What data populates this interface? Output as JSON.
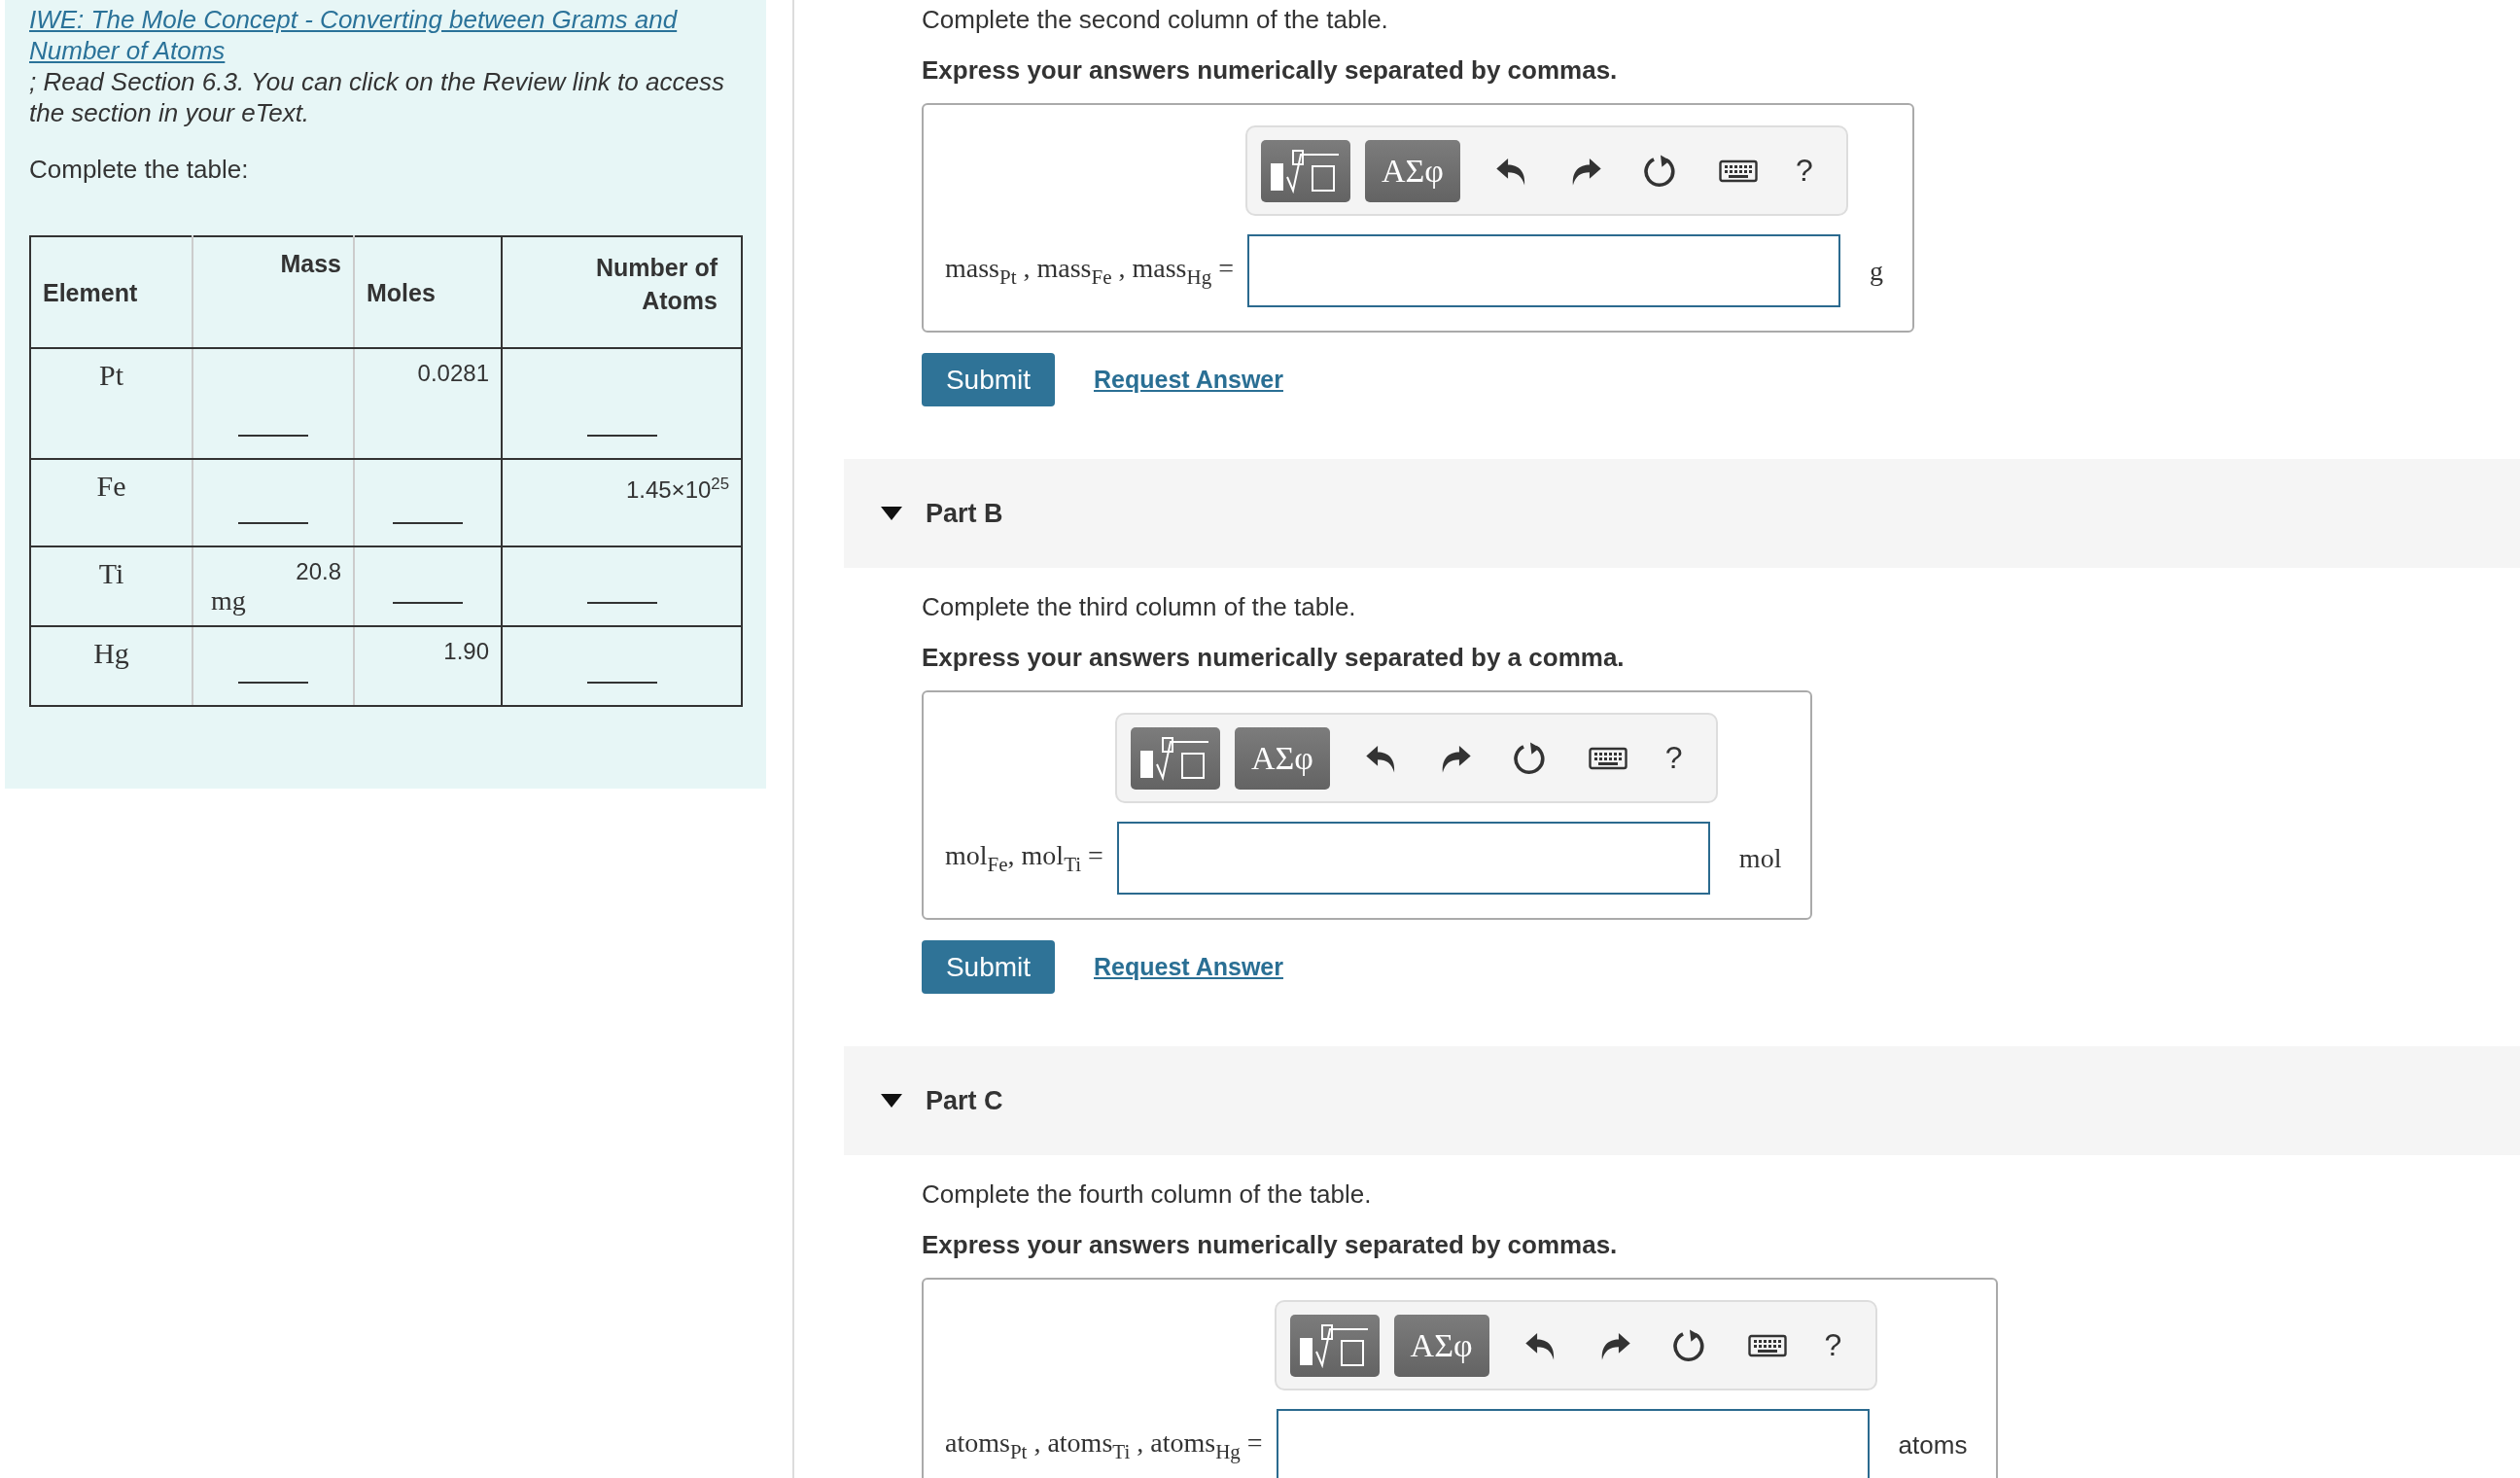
{
  "intro": {
    "link": "IWE: The Mole Concept - Converting between Grams and Number of Atoms",
    "note": "; Read Section 6.3. You can click on the Review link to access the section in your eText.",
    "instruction": "Complete the table:"
  },
  "table": {
    "columns": [
      "Element",
      "Mass",
      "Moles",
      "Number of Atoms"
    ],
    "rows": [
      {
        "cells": [
          {
            "kind": "element",
            "text": "Pt"
          },
          {
            "kind": "blank"
          },
          {
            "kind": "value",
            "text": "0.0281"
          },
          {
            "kind": "blank"
          }
        ]
      },
      {
        "cells": [
          {
            "kind": "element",
            "text": "Fe"
          },
          {
            "kind": "blank"
          },
          {
            "kind": "blank"
          },
          {
            "kind": "value",
            "text": "1.45×10$^{25}$"
          }
        ]
      },
      {
        "cells": [
          {
            "kind": "element",
            "text": "Ti"
          },
          {
            "kind": "value",
            "text": "20.8",
            "unit": "mg"
          },
          {
            "kind": "blank"
          },
          {
            "kind": "blank"
          }
        ]
      },
      {
        "cells": [
          {
            "kind": "element",
            "text": "Hg"
          },
          {
            "kind": "blank"
          },
          {
            "kind": "value",
            "text": "1.90"
          },
          {
            "kind": "blank"
          }
        ]
      }
    ]
  },
  "parts": [
    {
      "prompt": "Complete the second column of the table.",
      "instruction": "Express your answers numerically separated by commas.",
      "toolbar": {
        "symbols": "ΑΣφ",
        "help": "?"
      },
      "label": "mass$_{Pt}$ , mass$_{Fe}$ , mass$_{Hg}$ =",
      "unit": "g",
      "submit": "Submit",
      "request": "Request Answer"
    },
    {
      "header": {
        "title": "Part B",
        "expanded": true
      },
      "prompt": "Complete the third column of the table.",
      "instruction": "Express your answers numerically separated by a comma.",
      "toolbar": {
        "symbols": "ΑΣφ",
        "help": "?"
      },
      "label": "mol$_{Fe}$, mol$_{Ti}$ =",
      "unit": "mol",
      "submit": "Submit",
      "request": "Request Answer"
    },
    {
      "header": {
        "title": "Part C",
        "expanded": true
      },
      "prompt": "Complete the fourth column of the table.",
      "instruction": "Express your answers numerically separated by commas.",
      "toolbar": {
        "symbols": "ΑΣφ",
        "help": "?"
      },
      "label": "atoms$_{Pt}$ , atoms$_{Ti}$ , atoms$_{Hg}$ =",
      "unit": "atoms"
    }
  ]
}
